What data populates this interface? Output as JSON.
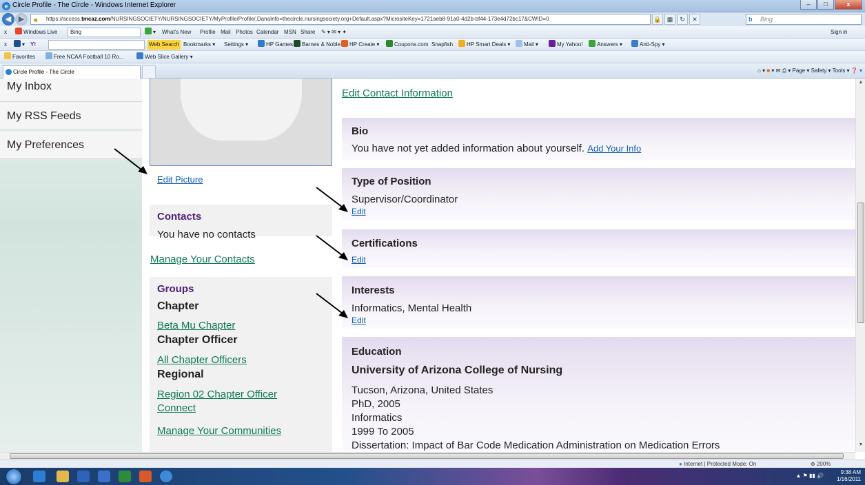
{
  "window": {
    "title": "Circle Profile - The Circle - Windows Internet Explorer",
    "controls": [
      "–",
      "□",
      "x"
    ]
  },
  "address": {
    "prefix": "https://access.",
    "host": "tmcaz.com",
    "path": "/NURSINGSOCIETY/NURSINGSOCIETY/MyProfile/Profile/,DanaInfo=thecircle.nursingsociety.org+Default.aspx?MicrositeKey=1721aeb8-91a0-4d2b-bf44-173e4d72bc17&CWID=0"
  },
  "search": {
    "placeholder": "Bing",
    "logo": "b"
  },
  "toolbar1": {
    "close": "x",
    "windows_live": "Windows Live",
    "search_value": "Bing",
    "links": [
      "What's New",
      "Profile",
      "Mail",
      "Photos",
      "Calendar",
      "MSN",
      "Share"
    ],
    "signin": "Sign in"
  },
  "toolbar2": {
    "close": "x",
    "yahoo": "Y!",
    "web_search": "Web Search",
    "items": [
      "Bookmarks ▾",
      "Settings ▾",
      "HP Games",
      "Barnes & Noble",
      "HP Create ▾",
      "Coupons.com",
      "Snapfish",
      "HP Smart Deals ▾",
      "Mail ▾",
      "My Yahoo!",
      "Answers ▾",
      "Anti-Spy ▾"
    ]
  },
  "favorites_bar": {
    "favorites": "Favorites",
    "items": [
      "Free NCAA Football 10 Ro...",
      "Web Slice Gallery ▾"
    ]
  },
  "tab": {
    "label": "Circle Profile - The Circle"
  },
  "command_bar": {
    "items": [
      "Page ▾",
      "Safety ▾",
      "Tools ▾"
    ]
  },
  "left_nav": {
    "items": [
      "My Inbox",
      "My RSS Feeds",
      "My Preferences"
    ]
  },
  "profile": {
    "edit_picture": "Edit Picture",
    "contacts": {
      "title": "Contacts",
      "empty": "You have no contacts",
      "manage": "Manage Your Contacts"
    },
    "groups": {
      "title": "Groups",
      "chapter_heading": "Chapter",
      "chapter_link": "Beta Mu Chapter",
      "officer_heading": "Chapter Officer",
      "officer_link": "All Chapter Officers",
      "regional_heading": "Regional",
      "regional_link_line1": "Region 02 Chapter Officer",
      "regional_link_line2": "Connect",
      "manage": "Manage Your Communities"
    }
  },
  "details": {
    "edit_contact": "Edit Contact Information",
    "bio": {
      "title": "Bio",
      "text": "You have not yet added information about yourself.",
      "link": "Add Your Info"
    },
    "position": {
      "title": "Type of Position",
      "value": "Supervisor/Coordinator",
      "edit": "Edit"
    },
    "certifications": {
      "title": "Certifications",
      "edit": "Edit"
    },
    "interests": {
      "title": "Interests",
      "value": "Informatics, Mental Health",
      "edit": "Edit"
    },
    "education": {
      "title": "Education",
      "school": "University of Arizona College of Nursing",
      "location": "Tucson, Arizona, United States",
      "degree": "PhD, 2005",
      "field": "Informatics",
      "years": "1999 To 2005",
      "dissertation": "Dissertation: Impact of Bar Code Medication Administration on Medication Errors"
    }
  },
  "status": {
    "zone": "Internet | Protected Mode: On",
    "zoom": "⊕ 200%"
  },
  "clock": {
    "time": "9:38 AM",
    "date": "1/16/2011"
  },
  "colors": {
    "link_blue": "#0f5fb5",
    "link_green": "#0e7a52",
    "section_purple": "#4b1f7a",
    "panel_lavender": "#e3dbee"
  }
}
